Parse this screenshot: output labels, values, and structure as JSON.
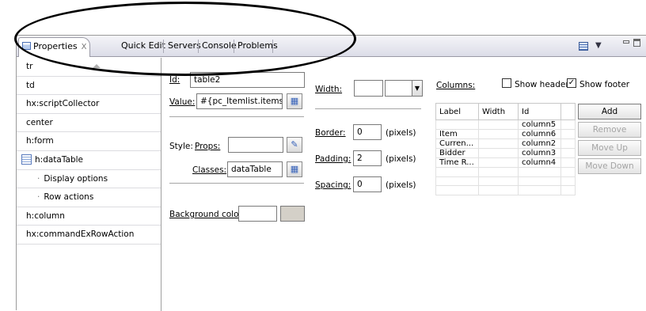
{
  "tabs": [
    {
      "label": "Properties",
      "active": true
    },
    {
      "label": "Quick Edit"
    },
    {
      "label": "Servers"
    },
    {
      "label": "Console"
    },
    {
      "label": "Problems"
    }
  ],
  "tab_close": "X",
  "tag_list": [
    {
      "label": "tr"
    },
    {
      "label": "td"
    },
    {
      "label": "hx:scriptCollector"
    },
    {
      "label": "center"
    },
    {
      "label": "h:form"
    },
    {
      "label": "h:dataTable"
    },
    {
      "label": "Display options"
    },
    {
      "label": "Row actions"
    },
    {
      "label": "h:column"
    },
    {
      "label": "hx:commandExRowAction"
    }
  ],
  "form": {
    "id_label": "Id:",
    "id_value": "table2",
    "value_label": "Value:",
    "value_value": "#{pc_Itemlist.items}",
    "style_label": "Style:",
    "props_label": "Props:",
    "props_value": "",
    "classes_label": "Classes:",
    "classes_value": "dataTable",
    "background_label": "Background color:",
    "width_label": "Width:",
    "width_value": "",
    "border_label": "Border:",
    "border_value": "0",
    "padding_label": "Padding:",
    "padding_value": "2",
    "spacing_label": "Spacing:",
    "spacing_value": "0",
    "pixels_label": "(pixels)"
  },
  "columns": {
    "label": "Columns:",
    "show_header_label": "Show header",
    "show_header_checked": false,
    "show_footer_label": "Show footer",
    "show_footer_checked": true,
    "headers": [
      "Label",
      "Width",
      "Id"
    ],
    "rows": [
      {
        "label": "",
        "width": "",
        "id": "column5"
      },
      {
        "label": "Item",
        "width": "",
        "id": "column6"
      },
      {
        "label": "Curren...",
        "width": "",
        "id": "column2"
      },
      {
        "label": "Bidder",
        "width": "",
        "id": "column3"
      },
      {
        "label": "Time R...",
        "width": "",
        "id": "column4"
      }
    ],
    "buttons": {
      "add": "Add",
      "remove": "Remove",
      "move_up": "Move Up",
      "move_down": "Move Down"
    }
  }
}
